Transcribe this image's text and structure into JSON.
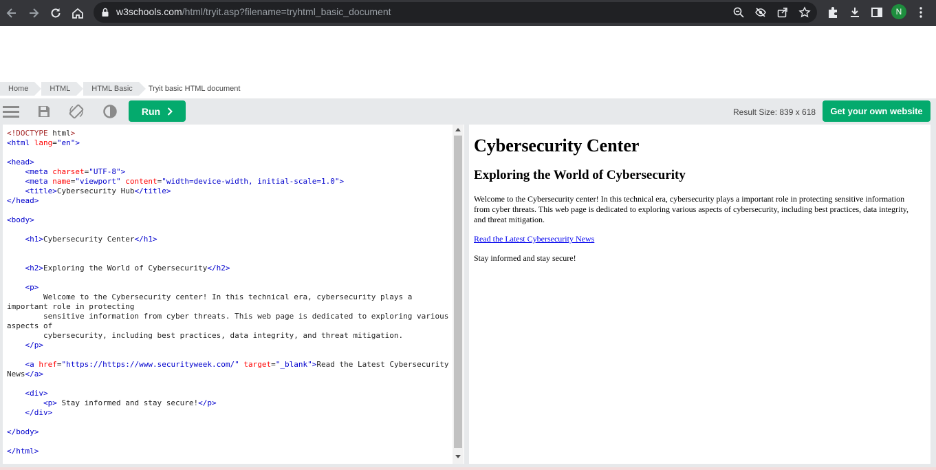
{
  "browser": {
    "url_host": "w3schools.com",
    "url_path": "/html/tryit.asp?filename=tryhtml_basic_document",
    "profile_initial": "N",
    "icons": [
      "back-arrow-icon",
      "forward-arrow-icon",
      "reload-icon",
      "home-icon",
      "lock-icon",
      "zoom-icon",
      "eye-slash-icon",
      "share-icon",
      "star-icon",
      "puzzle-icon",
      "download-icon",
      "sidepanel-icon",
      "kebab-menu-icon"
    ]
  },
  "breadcrumbs": [
    "Home",
    "HTML",
    "HTML Basic",
    "Tryit basic HTML document"
  ],
  "toolbar": {
    "run_label": "Run",
    "result_size": "Result Size: 839 x 618",
    "own_website_label": "Get your own website",
    "icons": [
      "menu-icon",
      "save-icon",
      "rotate-icon",
      "contrast-icon"
    ]
  },
  "editor": {
    "lines": [
      "<!DOCTYPE html>",
      "<html lang=\"en\">",
      "",
      "<head>",
      "    <meta charset=\"UTF-8\">",
      "    <meta name=\"viewport\" content=\"width=device-width, initial-scale=1.0\">",
      "    <title>Cybersecurity Hub</title>",
      "</head>",
      "",
      "<body>",
      "",
      "    <h1>Cybersecurity Center</h1>",
      "",
      "",
      "    <h2>Exploring the World of Cybersecurity</h2>",
      "",
      "    <p>",
      "        Welcome to the Cybersecurity center! In this technical era, cybersecurity plays a important role in protecting",
      "        sensitive information from cyber threats. This web page is dedicated to exploring various aspects of",
      "        cybersecurity, including best practices, data integrity, and threat mitigation.",
      "    </p>",
      "",
      "    <a href=\"https://https://www.securityweek.com/\" target=\"_blank\">Read the Latest Cybersecurity News</a>",
      "",
      "    <div>",
      "        <p> Stay informed and stay secure!</p>",
      "    </div>",
      "",
      "</body>",
      "",
      "</html>"
    ]
  },
  "result": {
    "h1": "Cybersecurity Center",
    "h2": "Exploring the World of Cybersecurity",
    "intro": "Welcome to the Cybersecurity center! In this technical era, cybersecurity plays a important role in protecting sensitive information from cyber threats. This web page is dedicated to exploring various aspects of cybersecurity, including best practices, data integrity, and threat mitigation.",
    "link": "Read the Latest Cybersecurity News",
    "stay": "Stay informed and stay secure!"
  },
  "colors": {
    "accent_green": "#04aa6d",
    "chrome_dark": "#35363a",
    "toolbar_gray": "#e7e9eb"
  }
}
